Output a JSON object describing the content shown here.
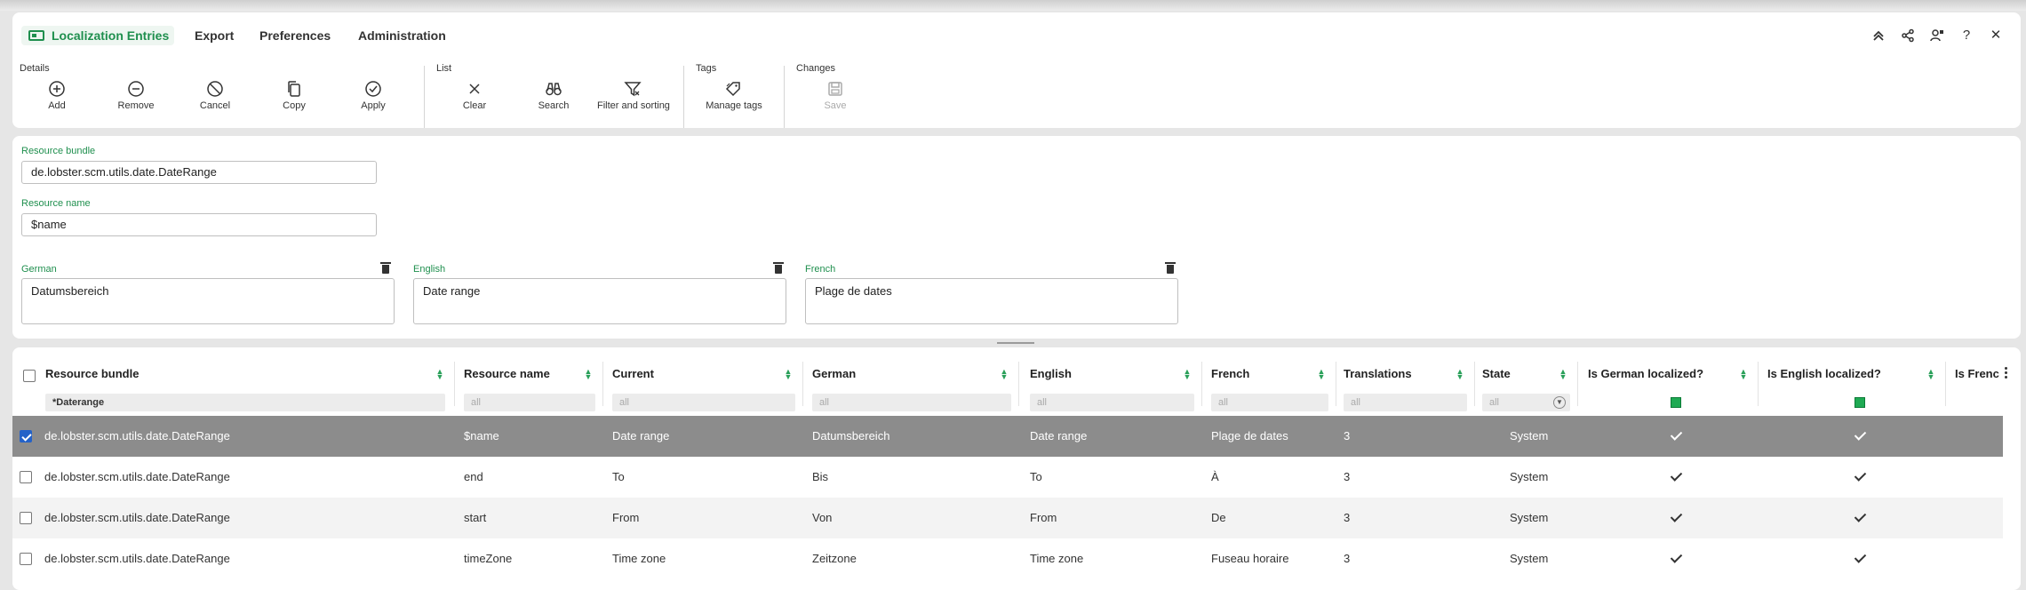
{
  "menu": {
    "app_title": "Localization Entries",
    "items": [
      "Export",
      "Preferences",
      "Administration"
    ]
  },
  "window_controls": [
    "collapse-icon",
    "share-icon",
    "user-settings-icon",
    "help-icon",
    "close-icon"
  ],
  "window_controls_glyphs": {
    "help": "?",
    "close": "✕"
  },
  "ribbon": {
    "groups": {
      "details": "Details",
      "list": "List",
      "tags": "Tags",
      "changes": "Changes"
    },
    "buttons": {
      "add": "Add",
      "remove": "Remove",
      "cancel": "Cancel",
      "copy": "Copy",
      "apply": "Apply",
      "clear": "Clear",
      "search": "Search",
      "filter_sorting": "Filter and sorting",
      "manage_tags": "Manage tags",
      "save": "Save"
    }
  },
  "form": {
    "resource_bundle": {
      "label": "Resource bundle",
      "value": "de.lobster.scm.utils.date.DateRange"
    },
    "resource_name": {
      "label": "Resource name",
      "value": "$name"
    },
    "german": {
      "label": "German",
      "value": "Datumsbereich"
    },
    "english": {
      "label": "English",
      "value": "Date range"
    },
    "french": {
      "label": "French",
      "value": "Plage de dates"
    }
  },
  "grid": {
    "headers": {
      "bundle": "Resource bundle",
      "name": "Resource name",
      "current": "Current",
      "german": "German",
      "english": "English",
      "french": "French",
      "translations": "Translations",
      "state": "State",
      "german_loc": "Is German localized?",
      "english_loc": "Is English localized?",
      "french_loc": "Is Frenc"
    },
    "filters": {
      "bundle": "*Daterange",
      "placeholder": "all"
    },
    "rows": [
      {
        "bundle": "de.lobster.scm.utils.date.DateRange",
        "name": "$name",
        "current": "Date range",
        "german": "Datumsbereich",
        "english": "Date range",
        "french": "Plage de dates",
        "translations": "3",
        "state": "System",
        "selected": true
      },
      {
        "bundle": "de.lobster.scm.utils.date.DateRange",
        "name": "end",
        "current": "To",
        "german": "Bis",
        "english": "To",
        "french": "À",
        "translations": "3",
        "state": "System",
        "selected": false
      },
      {
        "bundle": "de.lobster.scm.utils.date.DateRange",
        "name": "start",
        "current": "From",
        "german": "Von",
        "english": "From",
        "french": "De",
        "translations": "3",
        "state": "System",
        "selected": false
      },
      {
        "bundle": "de.lobster.scm.utils.date.DateRange",
        "name": "timeZone",
        "current": "Time zone",
        "german": "Zeitzone",
        "english": "Time zone",
        "french": "Fuseau horaire",
        "translations": "3",
        "state": "System",
        "selected": false
      }
    ]
  },
  "colors": {
    "accent": "#1f8f4e",
    "selected_row": "#8c8c8c",
    "checkbox_selected": "#2462c8"
  }
}
